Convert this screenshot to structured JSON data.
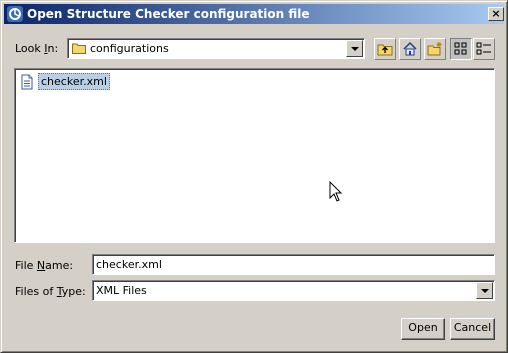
{
  "window": {
    "title": "Open Structure Checker configuration file",
    "close_label": "×"
  },
  "lookin": {
    "label_prefix": "Look ",
    "label_mnemonic": "I",
    "label_suffix": "n:",
    "value": "configurations"
  },
  "toolbar": {
    "buttons": [
      "up-one-level",
      "home",
      "create-new-folder",
      "list-view",
      "details-view"
    ],
    "active": "list-view"
  },
  "files": [
    {
      "name": "checker.xml",
      "selected": true
    }
  ],
  "filename": {
    "label_prefix": "File ",
    "label_mnemonic": "N",
    "label_suffix": "ame:",
    "value": "checker.xml"
  },
  "filetype": {
    "label_prefix": "Files of ",
    "label_mnemonic": "T",
    "label_suffix": "ype:",
    "value": "XML Files"
  },
  "actions": {
    "open_label": "Open",
    "cancel_label": "Cancel"
  },
  "colors": {
    "title_start": "#0a246a",
    "title_end": "#a6caf0",
    "selection": "#b8cfe5",
    "face": "#d4d0c8"
  }
}
